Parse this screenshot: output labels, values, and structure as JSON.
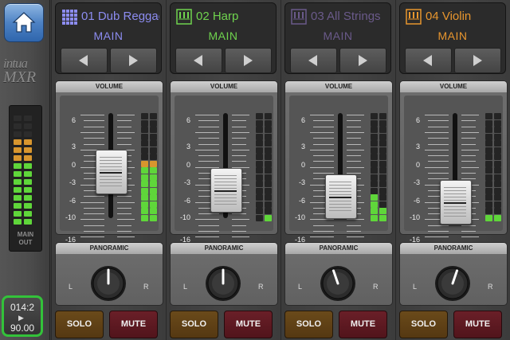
{
  "app": {
    "brand_line1": "intua",
    "brand_line2": "MXR"
  },
  "main_out": {
    "label_line1": "MAIN",
    "label_line2": "OUT",
    "level": 0.78
  },
  "transport": {
    "position": "014:2",
    "play_icon": "play-icon",
    "tempo": "90.00"
  },
  "scale_labels": [
    "6",
    "3",
    "0",
    "-3",
    "-6",
    "-10",
    "-16",
    "∞"
  ],
  "panel_titles": {
    "volume": "VOLUME",
    "panoramic": "PANORAMIC",
    "pan_left": "L",
    "pan_right": "R"
  },
  "buttons": {
    "solo": "SOLO",
    "mute": "MUTE"
  },
  "tracks": [
    {
      "name": "01 Dub Reggae",
      "mode": "MAIN",
      "icon": "grid-pad-icon",
      "color": "#8c8cf0",
      "fader": 0.64,
      "meter_left": 0.58,
      "meter_right": 0.58,
      "pan": 0.5
    },
    {
      "name": "02 Harp",
      "mode": "MAIN",
      "icon": "piano-keys-icon",
      "color": "#6fd34e",
      "fader": 0.46,
      "meter_left": 0.0,
      "meter_right": 0.06,
      "pan": 0.5
    },
    {
      "name": "03 All Strings",
      "mode": "MAIN",
      "icon": "piano-keys-icon",
      "color": "#6a5a8a",
      "fader": 0.4,
      "meter_left": 0.25,
      "meter_right": 0.12,
      "pan": 0.43
    },
    {
      "name": "04 Violin",
      "mode": "MAIN",
      "icon": "piano-keys-icon",
      "color": "#e8962e",
      "fader": 0.34,
      "meter_left": 0.06,
      "meter_right": 0.06,
      "pan": 0.57
    }
  ]
}
